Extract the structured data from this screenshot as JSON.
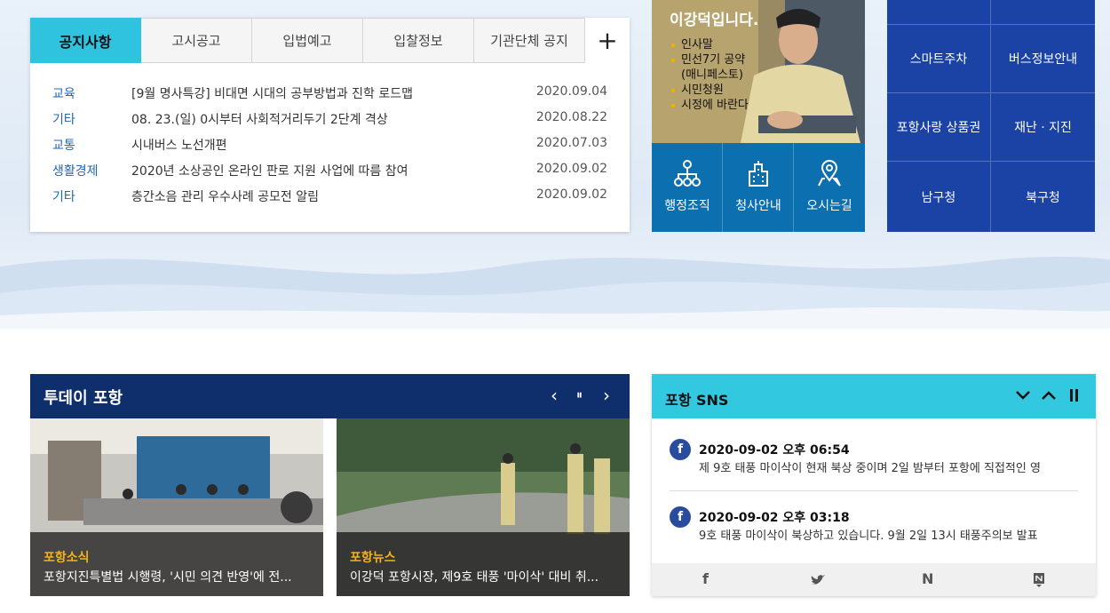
{
  "notice": {
    "tabs": [
      "공지사항",
      "고시공고",
      "입법예고",
      "입찰정보",
      "기관단체 공지"
    ],
    "plus": "+",
    "items": [
      {
        "category": "교육",
        "title": "[9월 명사특강] 비대면 시대의 공부방법과 진학 로드맵",
        "date": "2020.09.04"
      },
      {
        "category": "기타",
        "title": "08. 23.(일) 0시부터 사회적거리두기 2단계 격상",
        "date": "2020.08.22"
      },
      {
        "category": "교통",
        "title": "시내버스 노선개편",
        "date": "2020.07.03"
      },
      {
        "category": "생활경제",
        "title": "2020년 소상공인 온라인 판로 지원 사업에 따름 참여",
        "date": "2020.09.02"
      },
      {
        "category": "기타",
        "title": "층간소음 관리 우수사례 공모전 알림",
        "date": "2020.09.02"
      }
    ]
  },
  "mayor": {
    "name": "이강덕입니다.",
    "links": [
      "인사말",
      "민선7기 공약\n(매니페스토)",
      "시민청원",
      "시정에 바란다"
    ],
    "buttons": [
      "행정조직",
      "청사안내",
      "오시는길"
    ]
  },
  "quick": [
    "스마트주차",
    "버스정보안내",
    "포항사랑 상품권",
    "재난 · 지진",
    "남구청",
    "북구청"
  ],
  "today": {
    "title": "투데이 포항",
    "prev": "‹",
    "pause": "⏸",
    "next": "›",
    "cards": [
      {
        "kicker": "포항소식",
        "caption": "포항지진특별법 시행령, '시민 의견 반영'에 전..."
      },
      {
        "kicker": "포항뉴스",
        "caption": "이강덕 포항시장, 제9호 태풍 '마이삭' 대비 취..."
      }
    ]
  },
  "sns": {
    "title": "포항 SNS",
    "posts": [
      {
        "date": "2020-09-02 오후 06:54",
        "text": "제 9호 태풍 마이삭이 현재 북상 중이며 2일 밤부터 포항에 직접적인 영"
      },
      {
        "date": "2020-09-02 오후 03:18",
        "text": "9호 태풍 마이삭이 북상하고 있습니다.    9월 2일 13시 태풍주의보 발표"
      }
    ],
    "footer": [
      "f",
      "🐦",
      "N",
      "N"
    ]
  },
  "colors": {
    "accent": "#2fc3e0",
    "navy": "#0f2e6c",
    "blue": "#1a43a5",
    "teal": "#0c6fb0",
    "orange": "#f1b21c"
  }
}
